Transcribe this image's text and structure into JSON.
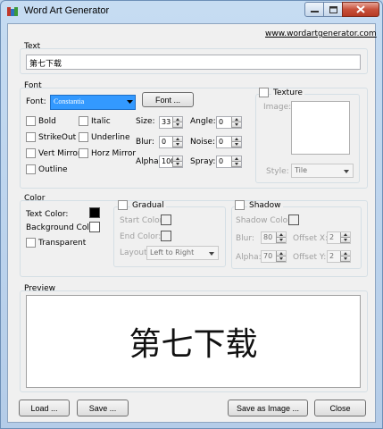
{
  "window": {
    "title": "Word Art Generator"
  },
  "header": {
    "website": "www.wordartgenerator.com"
  },
  "text_section": {
    "label": "Text",
    "value": "第七下载"
  },
  "font_section": {
    "label": "Font",
    "font_label": "Font:",
    "font_value": "Constantia",
    "font_button": "Font ...",
    "checkboxes": {
      "bold": "Bold",
      "italic": "Italic",
      "strikeout": "StrikeOut",
      "underline": "Underline",
      "vert_mirror": "Vert Mirror",
      "horz_mirror": "Horz Mirror",
      "outline": "Outline"
    },
    "size_label": "Size:",
    "size_value": "33",
    "blur_label": "Blur:",
    "blur_value": "0",
    "alpha_label": "Alpha:",
    "alpha_value": "100",
    "angle_label": "Angle:",
    "angle_value": "0",
    "noise_label": "Noise:",
    "noise_value": "0",
    "spray_label": "Spray:",
    "spray_value": "0"
  },
  "texture": {
    "label": "Texture",
    "image_label": "Image:",
    "style_label": "Style:",
    "style_value": "Tile"
  },
  "color_section": {
    "label": "Color",
    "text_color_label": "Text Color:",
    "background_color_label": "Background Color",
    "transparent_label": "Transparent",
    "text_color": "#000000",
    "background_color": "#ffffff"
  },
  "gradual": {
    "label": "Gradual",
    "start_color_label": "Start Color:",
    "end_color_label": "End Color:",
    "layout_label": "Layout:",
    "layout_value": "Left to Right"
  },
  "shadow": {
    "label": "Shadow",
    "shadow_color_label": "Shadow Color:",
    "blur_label": "Blur:",
    "blur_value": "80",
    "alpha_label": "Alpha:",
    "alpha_value": "70",
    "offset_x_label": "Offset X:",
    "offset_x_value": "2",
    "offset_y_label": "Offset Y:",
    "offset_y_value": "2"
  },
  "preview": {
    "label": "Preview",
    "text": "第七下载"
  },
  "buttons": {
    "load": "Load ...",
    "save": "Save ...",
    "save_as_image": "Save as Image ...",
    "close": "Close"
  }
}
